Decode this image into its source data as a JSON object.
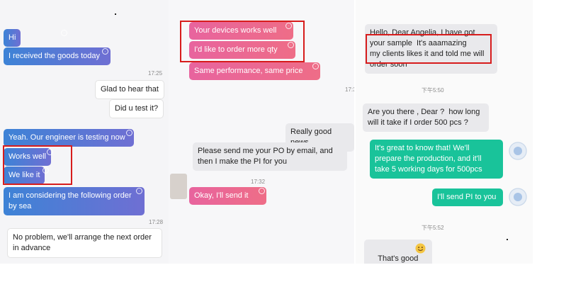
{
  "left_chat": {
    "messages": [
      "Hi",
      "I received the goods today",
      "Glad to hear that",
      "Did u test it?",
      "Yeah. Our engineer is testing now",
      "Works well",
      "We like it",
      "I am considering the following order\nby sea",
      "No problem, we'll arrange the next order\nin advance"
    ],
    "timestamps": [
      "17:25",
      "17:28"
    ]
  },
  "middle_chat": {
    "messages": [
      "Your devices works well",
      "I'd like to order more qty",
      "Same performance, same price",
      "Really good news",
      "Please send me your PO by email, and\nthen I make the PI for you",
      "Okay, I'll send it"
    ],
    "timestamps": [
      "17:3",
      "17:32"
    ]
  },
  "right_chat": {
    "messages": [
      "Hello, Dear Angelia, I have got\nyour sample  It's aaamazing\nmy clients likes it and told me will\norder soon",
      "Are you there , Dear ?  how long\nwill it take if I order 500 pcs ?",
      "It's great to know that! We'll\nprepare the production, and it'll\ntake 5 working days for 500pcs",
      "I'll send PI to you",
      "That's good"
    ],
    "timestamps": [
      "下午5:50",
      "下午5:52"
    ]
  },
  "colors": {
    "highlight": "#d71c1c",
    "left_bubble": "#5a78d6",
    "middle_bubble": "#ea6894",
    "right_bubble": "#19c39a"
  },
  "icons": [
    "smiley-avatar-icon",
    "grinning-emoji-icon",
    "read-receipt-icon"
  ]
}
